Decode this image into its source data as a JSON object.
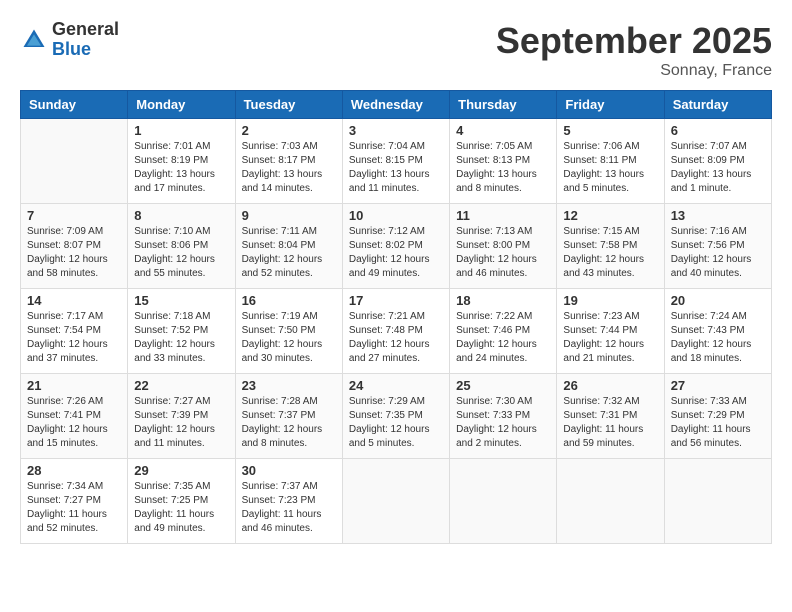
{
  "logo": {
    "general": "General",
    "blue": "Blue"
  },
  "header": {
    "month": "September 2025",
    "location": "Sonnay, France"
  },
  "weekdays": [
    "Sunday",
    "Monday",
    "Tuesday",
    "Wednesday",
    "Thursday",
    "Friday",
    "Saturday"
  ],
  "weeks": [
    [
      {
        "day": "",
        "info": ""
      },
      {
        "day": "1",
        "info": "Sunrise: 7:01 AM\nSunset: 8:19 PM\nDaylight: 13 hours\nand 17 minutes."
      },
      {
        "day": "2",
        "info": "Sunrise: 7:03 AM\nSunset: 8:17 PM\nDaylight: 13 hours\nand 14 minutes."
      },
      {
        "day": "3",
        "info": "Sunrise: 7:04 AM\nSunset: 8:15 PM\nDaylight: 13 hours\nand 11 minutes."
      },
      {
        "day": "4",
        "info": "Sunrise: 7:05 AM\nSunset: 8:13 PM\nDaylight: 13 hours\nand 8 minutes."
      },
      {
        "day": "5",
        "info": "Sunrise: 7:06 AM\nSunset: 8:11 PM\nDaylight: 13 hours\nand 5 minutes."
      },
      {
        "day": "6",
        "info": "Sunrise: 7:07 AM\nSunset: 8:09 PM\nDaylight: 13 hours\nand 1 minute."
      }
    ],
    [
      {
        "day": "7",
        "info": "Sunrise: 7:09 AM\nSunset: 8:07 PM\nDaylight: 12 hours\nand 58 minutes."
      },
      {
        "day": "8",
        "info": "Sunrise: 7:10 AM\nSunset: 8:06 PM\nDaylight: 12 hours\nand 55 minutes."
      },
      {
        "day": "9",
        "info": "Sunrise: 7:11 AM\nSunset: 8:04 PM\nDaylight: 12 hours\nand 52 minutes."
      },
      {
        "day": "10",
        "info": "Sunrise: 7:12 AM\nSunset: 8:02 PM\nDaylight: 12 hours\nand 49 minutes."
      },
      {
        "day": "11",
        "info": "Sunrise: 7:13 AM\nSunset: 8:00 PM\nDaylight: 12 hours\nand 46 minutes."
      },
      {
        "day": "12",
        "info": "Sunrise: 7:15 AM\nSunset: 7:58 PM\nDaylight: 12 hours\nand 43 minutes."
      },
      {
        "day": "13",
        "info": "Sunrise: 7:16 AM\nSunset: 7:56 PM\nDaylight: 12 hours\nand 40 minutes."
      }
    ],
    [
      {
        "day": "14",
        "info": "Sunrise: 7:17 AM\nSunset: 7:54 PM\nDaylight: 12 hours\nand 37 minutes."
      },
      {
        "day": "15",
        "info": "Sunrise: 7:18 AM\nSunset: 7:52 PM\nDaylight: 12 hours\nand 33 minutes."
      },
      {
        "day": "16",
        "info": "Sunrise: 7:19 AM\nSunset: 7:50 PM\nDaylight: 12 hours\nand 30 minutes."
      },
      {
        "day": "17",
        "info": "Sunrise: 7:21 AM\nSunset: 7:48 PM\nDaylight: 12 hours\nand 27 minutes."
      },
      {
        "day": "18",
        "info": "Sunrise: 7:22 AM\nSunset: 7:46 PM\nDaylight: 12 hours\nand 24 minutes."
      },
      {
        "day": "19",
        "info": "Sunrise: 7:23 AM\nSunset: 7:44 PM\nDaylight: 12 hours\nand 21 minutes."
      },
      {
        "day": "20",
        "info": "Sunrise: 7:24 AM\nSunset: 7:43 PM\nDaylight: 12 hours\nand 18 minutes."
      }
    ],
    [
      {
        "day": "21",
        "info": "Sunrise: 7:26 AM\nSunset: 7:41 PM\nDaylight: 12 hours\nand 15 minutes."
      },
      {
        "day": "22",
        "info": "Sunrise: 7:27 AM\nSunset: 7:39 PM\nDaylight: 12 hours\nand 11 minutes."
      },
      {
        "day": "23",
        "info": "Sunrise: 7:28 AM\nSunset: 7:37 PM\nDaylight: 12 hours\nand 8 minutes."
      },
      {
        "day": "24",
        "info": "Sunrise: 7:29 AM\nSunset: 7:35 PM\nDaylight: 12 hours\nand 5 minutes."
      },
      {
        "day": "25",
        "info": "Sunrise: 7:30 AM\nSunset: 7:33 PM\nDaylight: 12 hours\nand 2 minutes."
      },
      {
        "day": "26",
        "info": "Sunrise: 7:32 AM\nSunset: 7:31 PM\nDaylight: 11 hours\nand 59 minutes."
      },
      {
        "day": "27",
        "info": "Sunrise: 7:33 AM\nSunset: 7:29 PM\nDaylight: 11 hours\nand 56 minutes."
      }
    ],
    [
      {
        "day": "28",
        "info": "Sunrise: 7:34 AM\nSunset: 7:27 PM\nDaylight: 11 hours\nand 52 minutes."
      },
      {
        "day": "29",
        "info": "Sunrise: 7:35 AM\nSunset: 7:25 PM\nDaylight: 11 hours\nand 49 minutes."
      },
      {
        "day": "30",
        "info": "Sunrise: 7:37 AM\nSunset: 7:23 PM\nDaylight: 11 hours\nand 46 minutes."
      },
      {
        "day": "",
        "info": ""
      },
      {
        "day": "",
        "info": ""
      },
      {
        "day": "",
        "info": ""
      },
      {
        "day": "",
        "info": ""
      }
    ]
  ]
}
